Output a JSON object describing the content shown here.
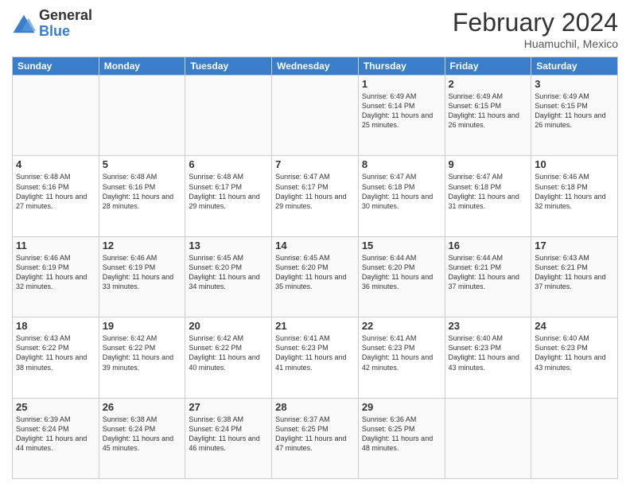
{
  "header": {
    "logo_general": "General",
    "logo_blue": "Blue",
    "month_title": "February 2024",
    "location": "Huamuchil, Mexico"
  },
  "days_of_week": [
    "Sunday",
    "Monday",
    "Tuesday",
    "Wednesday",
    "Thursday",
    "Friday",
    "Saturday"
  ],
  "weeks": [
    [
      {
        "day": "",
        "info": ""
      },
      {
        "day": "",
        "info": ""
      },
      {
        "day": "",
        "info": ""
      },
      {
        "day": "",
        "info": ""
      },
      {
        "day": "1",
        "info": "Sunrise: 6:49 AM\nSunset: 6:14 PM\nDaylight: 11 hours and 25 minutes."
      },
      {
        "day": "2",
        "info": "Sunrise: 6:49 AM\nSunset: 6:15 PM\nDaylight: 11 hours and 26 minutes."
      },
      {
        "day": "3",
        "info": "Sunrise: 6:49 AM\nSunset: 6:15 PM\nDaylight: 11 hours and 26 minutes."
      }
    ],
    [
      {
        "day": "4",
        "info": "Sunrise: 6:48 AM\nSunset: 6:16 PM\nDaylight: 11 hours and 27 minutes."
      },
      {
        "day": "5",
        "info": "Sunrise: 6:48 AM\nSunset: 6:16 PM\nDaylight: 11 hours and 28 minutes."
      },
      {
        "day": "6",
        "info": "Sunrise: 6:48 AM\nSunset: 6:17 PM\nDaylight: 11 hours and 29 minutes."
      },
      {
        "day": "7",
        "info": "Sunrise: 6:47 AM\nSunset: 6:17 PM\nDaylight: 11 hours and 29 minutes."
      },
      {
        "day": "8",
        "info": "Sunrise: 6:47 AM\nSunset: 6:18 PM\nDaylight: 11 hours and 30 minutes."
      },
      {
        "day": "9",
        "info": "Sunrise: 6:47 AM\nSunset: 6:18 PM\nDaylight: 11 hours and 31 minutes."
      },
      {
        "day": "10",
        "info": "Sunrise: 6:46 AM\nSunset: 6:18 PM\nDaylight: 11 hours and 32 minutes."
      }
    ],
    [
      {
        "day": "11",
        "info": "Sunrise: 6:46 AM\nSunset: 6:19 PM\nDaylight: 11 hours and 32 minutes."
      },
      {
        "day": "12",
        "info": "Sunrise: 6:46 AM\nSunset: 6:19 PM\nDaylight: 11 hours and 33 minutes."
      },
      {
        "day": "13",
        "info": "Sunrise: 6:45 AM\nSunset: 6:20 PM\nDaylight: 11 hours and 34 minutes."
      },
      {
        "day": "14",
        "info": "Sunrise: 6:45 AM\nSunset: 6:20 PM\nDaylight: 11 hours and 35 minutes."
      },
      {
        "day": "15",
        "info": "Sunrise: 6:44 AM\nSunset: 6:20 PM\nDaylight: 11 hours and 36 minutes."
      },
      {
        "day": "16",
        "info": "Sunrise: 6:44 AM\nSunset: 6:21 PM\nDaylight: 11 hours and 37 minutes."
      },
      {
        "day": "17",
        "info": "Sunrise: 6:43 AM\nSunset: 6:21 PM\nDaylight: 11 hours and 37 minutes."
      }
    ],
    [
      {
        "day": "18",
        "info": "Sunrise: 6:43 AM\nSunset: 6:22 PM\nDaylight: 11 hours and 38 minutes."
      },
      {
        "day": "19",
        "info": "Sunrise: 6:42 AM\nSunset: 6:22 PM\nDaylight: 11 hours and 39 minutes."
      },
      {
        "day": "20",
        "info": "Sunrise: 6:42 AM\nSunset: 6:22 PM\nDaylight: 11 hours and 40 minutes."
      },
      {
        "day": "21",
        "info": "Sunrise: 6:41 AM\nSunset: 6:23 PM\nDaylight: 11 hours and 41 minutes."
      },
      {
        "day": "22",
        "info": "Sunrise: 6:41 AM\nSunset: 6:23 PM\nDaylight: 11 hours and 42 minutes."
      },
      {
        "day": "23",
        "info": "Sunrise: 6:40 AM\nSunset: 6:23 PM\nDaylight: 11 hours and 43 minutes."
      },
      {
        "day": "24",
        "info": "Sunrise: 6:40 AM\nSunset: 6:23 PM\nDaylight: 11 hours and 43 minutes."
      }
    ],
    [
      {
        "day": "25",
        "info": "Sunrise: 6:39 AM\nSunset: 6:24 PM\nDaylight: 11 hours and 44 minutes."
      },
      {
        "day": "26",
        "info": "Sunrise: 6:38 AM\nSunset: 6:24 PM\nDaylight: 11 hours and 45 minutes."
      },
      {
        "day": "27",
        "info": "Sunrise: 6:38 AM\nSunset: 6:24 PM\nDaylight: 11 hours and 46 minutes."
      },
      {
        "day": "28",
        "info": "Sunrise: 6:37 AM\nSunset: 6:25 PM\nDaylight: 11 hours and 47 minutes."
      },
      {
        "day": "29",
        "info": "Sunrise: 6:36 AM\nSunset: 6:25 PM\nDaylight: 11 hours and 48 minutes."
      },
      {
        "day": "",
        "info": ""
      },
      {
        "day": "",
        "info": ""
      }
    ]
  ]
}
